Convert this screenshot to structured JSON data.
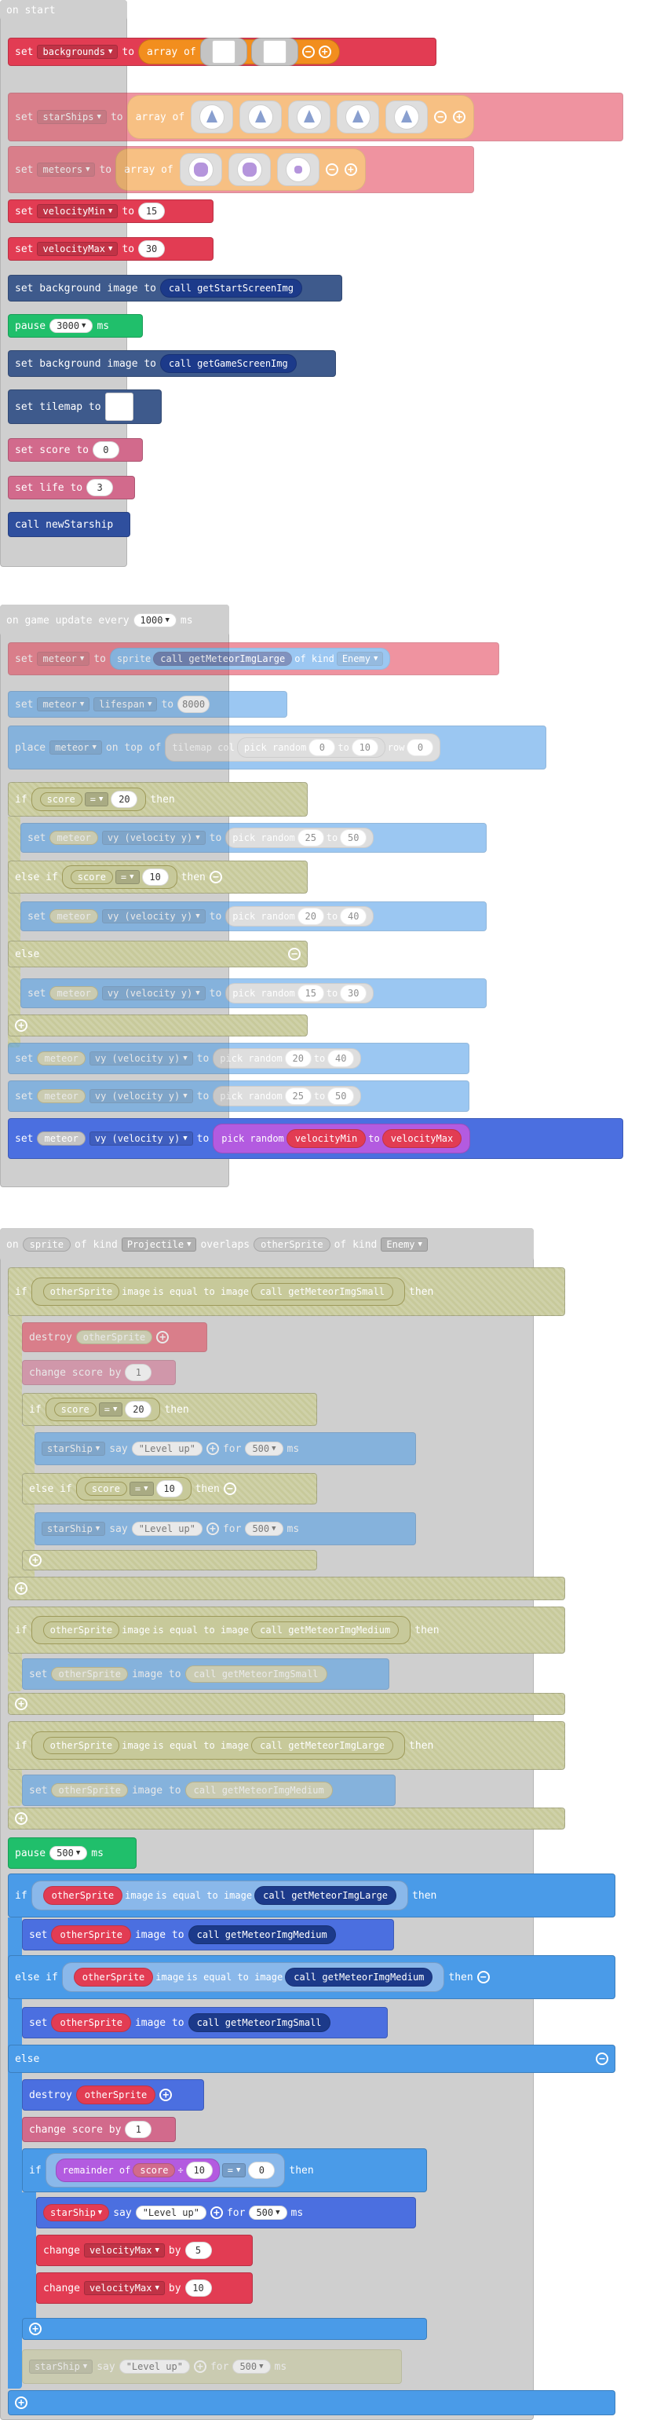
{
  "colors": {
    "events": "#cfcfcf",
    "variables": "#e23c53",
    "arrays": "#f28e1e",
    "loops": "#20bf6b",
    "scene": "#3e5a8c",
    "functions": "#2f4f9e",
    "sprites": "#4a9be8",
    "info": "#d26a8c",
    "logic": "#c7c99a",
    "math": "#8a3fd6"
  },
  "onstart": {
    "header": "on start",
    "set1": {
      "set": "set",
      "var": "backgrounds",
      "to": "to",
      "array": "array of"
    },
    "set2": {
      "set": "set",
      "var": "starShips",
      "to": "to",
      "array": "array of"
    },
    "set3": {
      "set": "set",
      "var": "meteors",
      "to": "to",
      "array": "array of"
    },
    "set4": {
      "set": "set",
      "var": "velocityMin",
      "to": "to",
      "val": "15"
    },
    "set5": {
      "set": "set",
      "var": "velocityMax",
      "to": "to",
      "val": "30"
    },
    "bg1": {
      "label": "set background image to",
      "call": "call getStartScreenImg"
    },
    "pause": {
      "label": "pause",
      "val": "3000",
      "unit": "ms"
    },
    "bg2": {
      "label": "set background image to",
      "call": "call getGameScreenImg"
    },
    "tilemap": {
      "label": "set tilemap to"
    },
    "score": {
      "label": "set score to",
      "val": "0"
    },
    "life": {
      "label": "set life to",
      "val": "3"
    },
    "call": {
      "label": "call newStarship"
    }
  },
  "update": {
    "header": "on game update every",
    "interval": "1000",
    "unit": "ms",
    "s1": {
      "set": "set",
      "var": "meteor",
      "to": "to",
      "sprite": "sprite",
      "call": "call getMeteorImgLarge",
      "kind": "of kind",
      "kindval": "Enemy"
    },
    "s2": {
      "set": "set",
      "var": "meteor",
      "prop": "lifespan",
      "to": "to",
      "val": "8000"
    },
    "place": {
      "label": "place",
      "var": "meteor",
      "ontop": "on top of",
      "tile": "tilemap col",
      "rand": "pick random",
      "a": "0",
      "to": "to",
      "b": "10",
      "row": "row",
      "rowv": "0"
    },
    "if1": {
      "if": "if",
      "var": "score",
      "op": "=",
      "val": "20",
      "then": "then"
    },
    "set_a": {
      "set": "set",
      "var": "meteor",
      "prop": "vy (velocity y)",
      "to": "to",
      "rand": "pick random",
      "a": "25",
      "to2": "to",
      "b": "50"
    },
    "elif": {
      "label": "else if",
      "var": "score",
      "op": "=",
      "val": "10",
      "then": "then"
    },
    "set_b": {
      "set": "set",
      "var": "meteor",
      "prop": "vy (velocity y)",
      "to": "to",
      "rand": "pick random",
      "a": "20",
      "to2": "to",
      "b": "40"
    },
    "else": {
      "label": "else"
    },
    "set_c": {
      "set": "set",
      "var": "meteor",
      "prop": "vy (velocity y)",
      "to": "to",
      "rand": "pick random",
      "a": "15",
      "to2": "to",
      "b": "30"
    },
    "set_d": {
      "set": "set",
      "var": "meteor",
      "prop": "vy (velocity y)",
      "to": "to",
      "rand": "pick random",
      "a": "20",
      "to2": "to",
      "b": "40"
    },
    "set_e": {
      "set": "set",
      "var": "meteor",
      "prop": "vy (velocity y)",
      "to": "to",
      "rand": "pick random",
      "a": "25",
      "to2": "to",
      "b": "50"
    },
    "set_f": {
      "set": "set",
      "var": "meteor",
      "prop": "vy (velocity y)",
      "to": "to",
      "rand": "pick random",
      "a": "velocityMin",
      "to2": "to",
      "b": "velocityMax"
    }
  },
  "overlap": {
    "header": {
      "on": "on",
      "sprite": "sprite",
      "ofkind": "of kind",
      "kind1": "Projectile",
      "overlaps": "overlaps",
      "other": "otherSprite",
      "ofkind2": "of kind",
      "kind2": "Enemy"
    },
    "ifA": {
      "if": "if",
      "var": "otherSprite",
      "image": "image",
      "eq": "is equal to image",
      "call": "call getMeteorImgSmall",
      "then": "then"
    },
    "destroyA": {
      "label": "destroy",
      "var": "otherSprite"
    },
    "changeA": {
      "label": "change score by",
      "val": "1"
    },
    "ifA2": {
      "if": "if",
      "var": "score",
      "op": "=",
      "val": "20",
      "then": "then"
    },
    "sayA": {
      "var": "starShip",
      "say": "say",
      "text": "\"Level up\"",
      "for": "for",
      "val": "500",
      "unit": "ms"
    },
    "elifA": {
      "label": "else if",
      "var": "score",
      "op": "=",
      "val": "10",
      "then": "then"
    },
    "sayB": {
      "var": "starShip",
      "say": "say",
      "text": "\"Level up\"",
      "for": "for",
      "val": "500",
      "unit": "ms"
    },
    "ifB": {
      "if": "if",
      "var": "otherSprite",
      "image": "image",
      "eq": "is equal to image",
      "call": "call getMeteorImgMedium",
      "then": "then"
    },
    "setB": {
      "set": "set",
      "var": "otherSprite",
      "image": "image to",
      "call": "call getMeteorImgSmall"
    },
    "ifC": {
      "if": "if",
      "var": "otherSprite",
      "image": "image",
      "eq": "is equal to image",
      "call": "call getMeteorImgLarge",
      "then": "then"
    },
    "setC": {
      "set": "set",
      "var": "otherSprite",
      "image": "image to",
      "call": "call getMeteorImgMedium"
    },
    "pause": {
      "label": "pause",
      "val": "500",
      "unit": "ms"
    },
    "ifD": {
      "if": "if",
      "var": "otherSprite",
      "image": "image",
      "eq": "is equal to image",
      "call": "call getMeteorImgLarge",
      "then": "then"
    },
    "setD": {
      "set": "set",
      "var": "otherSprite",
      "image": "image to",
      "call": "call getMeteorImgMedium"
    },
    "elifD": {
      "label": "else if",
      "var": "otherSprite",
      "image": "image",
      "eq": "is equal to image",
      "call": "call getMeteorImgMedium",
      "then": "then"
    },
    "setE": {
      "set": "set",
      "var": "otherSprite",
      "image": "image to",
      "call": "call getMeteorImgSmall"
    },
    "elseD": {
      "label": "else"
    },
    "destroyD": {
      "label": "destroy",
      "var": "otherSprite"
    },
    "changeD": {
      "label": "change score by",
      "val": "1"
    },
    "ifE": {
      "if": "if",
      "rem": "remainder of",
      "var": "score",
      "div": "÷",
      "val": "10",
      "op": "=",
      "val2": "0",
      "then": "then"
    },
    "sayE": {
      "var": "starShip",
      "say": "say",
      "text": "\"Level up\"",
      "for": "for",
      "val": "500",
      "unit": "ms"
    },
    "chg1": {
      "label": "change",
      "var": "velocityMax",
      "by": "by",
      "val": "5"
    },
    "chg2": {
      "label": "change",
      "var": "velocityMax",
      "by": "by",
      "val": "10"
    },
    "sayF": {
      "var": "starShip",
      "say": "say",
      "text": "\"Level up\"",
      "for": "for",
      "val": "500",
      "unit": "ms"
    }
  }
}
